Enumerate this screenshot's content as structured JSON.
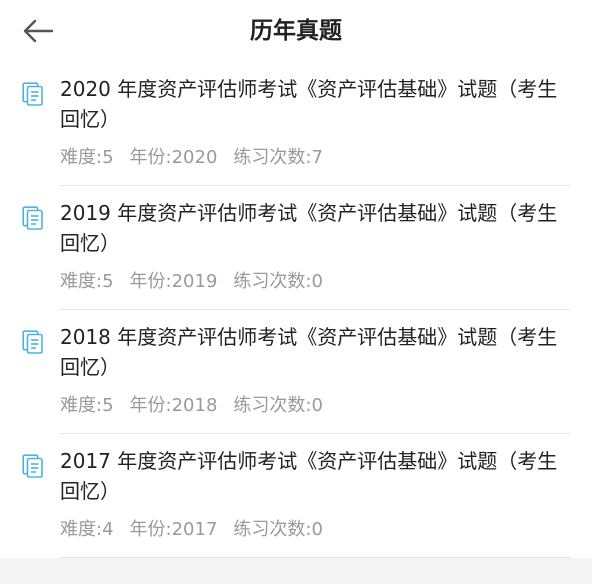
{
  "header": {
    "title": "历年真题",
    "back_icon": "arrow-left-icon"
  },
  "colors": {
    "accent_icon": "#4fb3e0",
    "title_text": "#222222",
    "meta_text": "#9a9a9a"
  },
  "items": [
    {
      "title": "2020 年度资产评估师考试《资产评估基础》试题（考生回忆）",
      "difficulty": "难度:5",
      "year": "年份:2020",
      "practice": "练习次数:7"
    },
    {
      "title": "2019 年度资产评估师考试《资产评估基础》试题（考生回忆）",
      "difficulty": "难度:5",
      "year": "年份:2019",
      "practice": "练习次数:0"
    },
    {
      "title": "2018 年度资产评估师考试《资产评估基础》试题（考生回忆）",
      "difficulty": "难度:5",
      "year": "年份:2018",
      "practice": "练习次数:0"
    },
    {
      "title": "2017 年度资产评估师考试《资产评估基础》试题（考生回忆）",
      "difficulty": "难度:4",
      "year": "年份:2017",
      "practice": "练习次数:0"
    }
  ]
}
